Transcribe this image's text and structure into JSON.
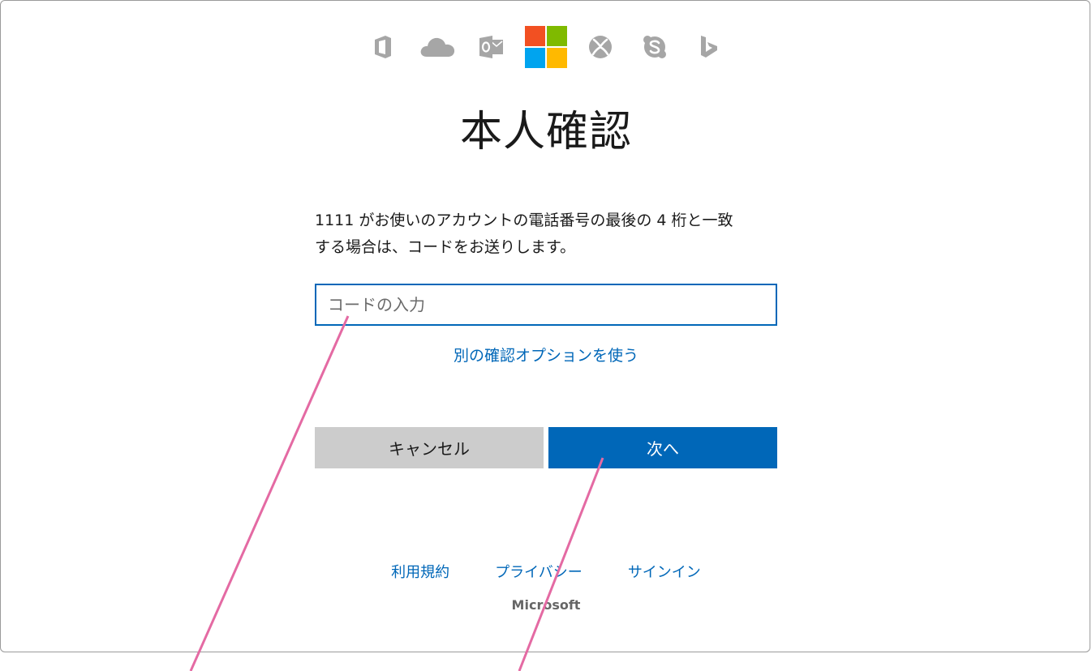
{
  "title": "本人確認",
  "description": {
    "line1": "1111 がお使いのアカウントの電話番号の最後の 4 桁と一致",
    "line2": "する場合は、コードをお送りします。"
  },
  "code_input": {
    "placeholder": "コードの入力",
    "value": ""
  },
  "alt_option_link": "別の確認オプションを使う",
  "buttons": {
    "cancel": "キャンセル",
    "next": "次へ"
  },
  "footer": {
    "links": [
      "利用規約",
      "プライバシー",
      "サインイン"
    ],
    "brand": "Microsoft"
  },
  "brand_icons": [
    "office-icon",
    "onedrive-icon",
    "outlook-icon",
    "microsoft-logo",
    "xbox-icon",
    "skype-icon",
    "bing-icon"
  ],
  "colors": {
    "accent": "#0067b8",
    "logo_red": "#f25022",
    "logo_green": "#7fba00",
    "logo_blue": "#00a4ef",
    "logo_yellow": "#ffb900",
    "annotation_pink": "#e46aa3"
  }
}
